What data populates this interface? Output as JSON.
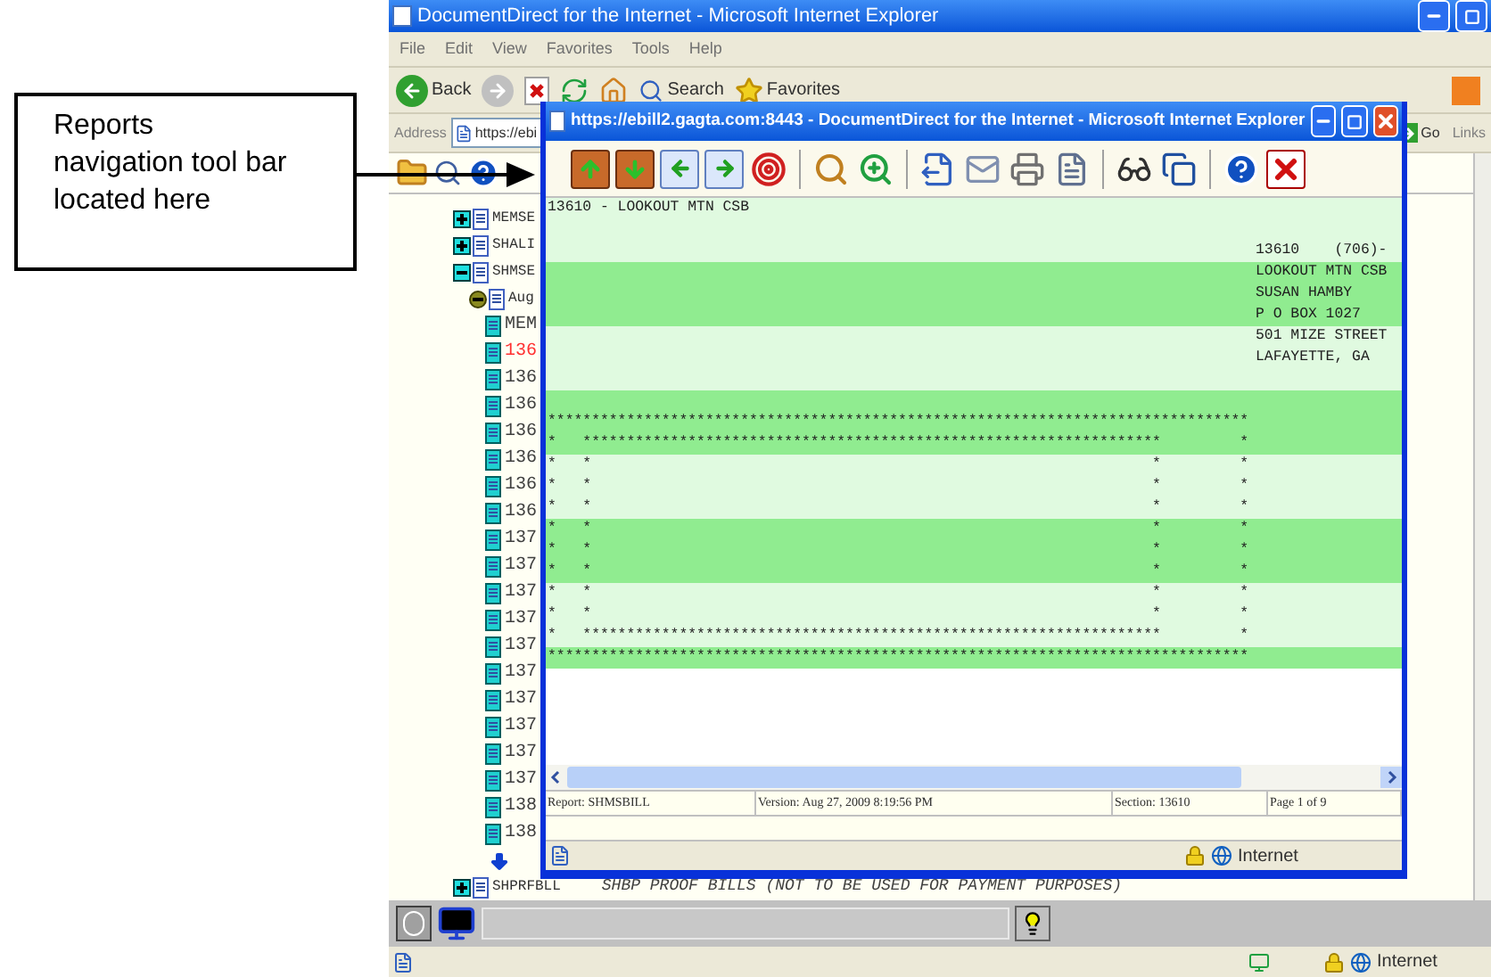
{
  "callout": {
    "text": "Reports navigation tool bar located here"
  },
  "main_window": {
    "title": "DocumentDirect for the Internet - Microsoft Internet Explorer",
    "menu": [
      "File",
      "Edit",
      "View",
      "Favorites",
      "Tools",
      "Help"
    ],
    "toolbar": {
      "back": "Back",
      "search": "Search",
      "favorites": "Favorites"
    },
    "address": {
      "label": "Address",
      "value": "https://ebi"
    },
    "go": "Go",
    "links": "Links",
    "tree": [
      {
        "kind": "report",
        "label": "MEMSE",
        "expanded": false
      },
      {
        "kind": "report",
        "label": "SHALI",
        "expanded": false
      },
      {
        "kind": "report",
        "label": "SHMSE",
        "expanded": true,
        "children": [
          {
            "kind": "version",
            "label": "Aug",
            "expanded": true,
            "children": [
              {
                "kind": "section",
                "label": "MEM",
                "current": false
              },
              {
                "kind": "section",
                "label": "136",
                "current": true
              },
              {
                "kind": "section",
                "label": "136",
                "current": false
              },
              {
                "kind": "section",
                "label": "136",
                "current": false
              },
              {
                "kind": "section",
                "label": "136",
                "current": false
              },
              {
                "kind": "section",
                "label": "136",
                "current": false
              },
              {
                "kind": "section",
                "label": "136",
                "current": false
              },
              {
                "kind": "section",
                "label": "136",
                "current": false
              },
              {
                "kind": "section",
                "label": "137",
                "current": false
              },
              {
                "kind": "section",
                "label": "137",
                "current": false
              },
              {
                "kind": "section",
                "label": "137",
                "current": false
              },
              {
                "kind": "section",
                "label": "137",
                "current": false
              },
              {
                "kind": "section",
                "label": "137",
                "current": false
              },
              {
                "kind": "section",
                "label": "137",
                "current": false
              },
              {
                "kind": "section",
                "label": "137",
                "current": false
              },
              {
                "kind": "section",
                "label": "137",
                "current": false
              },
              {
                "kind": "section",
                "label": "137",
                "current": false
              },
              {
                "kind": "section",
                "label": "137",
                "current": false
              },
              {
                "kind": "section",
                "label": "138",
                "current": false
              },
              {
                "kind": "section",
                "label": "138",
                "current": false
              },
              {
                "kind": "more"
              }
            ]
          }
        ]
      },
      {
        "kind": "report",
        "label": "SHPRFBLL",
        "description": "SHBP PROOF BILLS (NOT TO BE USED FOR PAYMENT PURPOSES)",
        "expanded": false
      }
    ],
    "status_zone": "Internet"
  },
  "popup": {
    "title": "https://ebill2.gagta.com:8443 - DocumentDirect for the Internet - Microsoft Internet Explorer",
    "toolbar": [
      {
        "kind": "first"
      },
      {
        "kind": "last"
      },
      {
        "kind": "prev"
      },
      {
        "kind": "next"
      },
      {
        "kind": "goto"
      },
      {
        "kind": "sep"
      },
      {
        "kind": "find"
      },
      {
        "kind": "find-next"
      },
      {
        "kind": "sep"
      },
      {
        "kind": "export"
      },
      {
        "kind": "mail"
      },
      {
        "kind": "print"
      },
      {
        "kind": "print-page"
      },
      {
        "kind": "sep"
      },
      {
        "kind": "view"
      },
      {
        "kind": "copy"
      },
      {
        "kind": "sep"
      },
      {
        "kind": "help"
      },
      {
        "kind": "close"
      }
    ],
    "report_lines": [
      {
        "kind": "text",
        "text": "13610 - LOOKOUT MTN CSB"
      },
      {
        "kind": "blank"
      },
      {
        "kind": "text",
        "right": "13610    (706)-"
      },
      {
        "kind": "text",
        "right": "LOOKOUT MTN CSB"
      },
      {
        "kind": "text",
        "right": "SUSAN HAMBY"
      },
      {
        "kind": "text",
        "right": "P O BOX 1027"
      },
      {
        "kind": "text",
        "right": "501 MIZE STREET"
      },
      {
        "kind": "text",
        "right": "LAFAYETTE, GA"
      },
      {
        "kind": "blank"
      },
      {
        "kind": "blank"
      },
      {
        "kind": "art",
        "text": "********************************************************************************\n*   ******************************************************************         *\n*   *                                                                *         *\n*   *                                                                *         *\n*   *                                                                *         *\n*   *                                                                *         *\n*   *                                                                *         *\n*   *                                                                *         *\n*   *                                                                *         *\n*   *                                                                *         *\n*   ******************************************************************         *\n********************************************************************************"
      }
    ],
    "footer": [
      "Report: SHMSBILL",
      "Version: Aug 27, 2009 8:19:56 PM",
      "Section: 13610",
      "Page 1 of 9"
    ],
    "status_zone": "Internet"
  }
}
